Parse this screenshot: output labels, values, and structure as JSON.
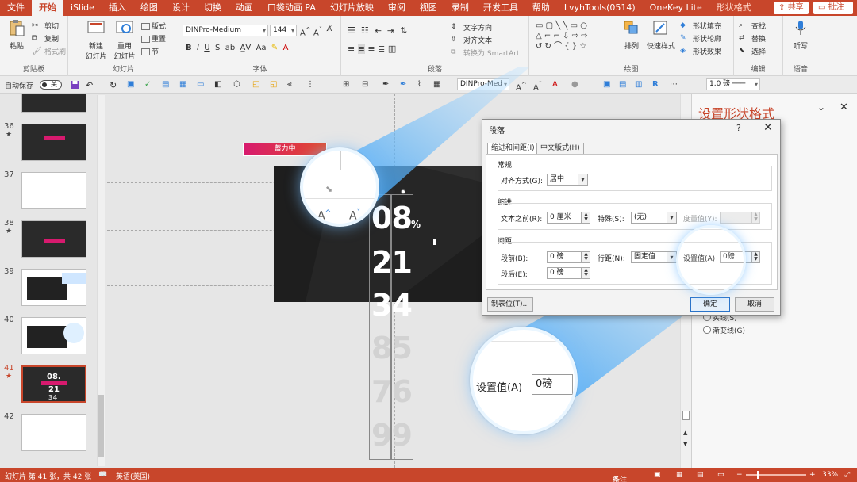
{
  "menu": {
    "tabs": [
      "文件",
      "开始",
      "iSlide",
      "插入",
      "绘图",
      "设计",
      "切换",
      "动画",
      "口袋动画 PA",
      "幻灯片放映",
      "审阅",
      "视图",
      "录制",
      "开发工具",
      "帮助",
      "LvyhTools(0514)",
      "OneKey Lite",
      "形状格式"
    ],
    "share": "共享",
    "comment": "批注"
  },
  "ribbon": {
    "clipboard": {
      "paste": "粘贴",
      "cut": "剪切",
      "copy": "复制",
      "painter": "格式刷",
      "label": "剪贴板"
    },
    "slides": {
      "new": "新建",
      "new2": "幻灯片",
      "reuse": "重用",
      "reuse2": "幻灯片",
      "layout": "版式",
      "reset": "重置",
      "section": "节",
      "label": "幻灯片"
    },
    "font": {
      "name": "DINPro-Medium",
      "size": "144",
      "label": "字体"
    },
    "paragraph": {
      "text_dir": "文字方向",
      "align_text": "对齐文本",
      "smartart": "转换为 SmartArt",
      "label": "段落"
    },
    "drawing": {
      "arrange": "排列",
      "quick_styles": "快速样式",
      "fill": "形状填充",
      "outline": "形状轮廓",
      "effect": "形状效果",
      "label": "绘图"
    },
    "editing": {
      "find": "查找",
      "replace": "替换",
      "select": "选择",
      "label": "编辑"
    },
    "voice": {
      "dictate": "听写",
      "label": "语音"
    }
  },
  "qat": {
    "autosave": "自动保存",
    "toggle": "关",
    "font": "DINPro-Med",
    "line_weight": "1.0 磅"
  },
  "thumbnails": [
    {
      "num": "36",
      "star": "★",
      "kind": "dark"
    },
    {
      "num": "37",
      "star": "",
      "kind": "blank"
    },
    {
      "num": "38",
      "star": "★",
      "kind": "dark"
    },
    {
      "num": "39",
      "star": "",
      "kind": "light"
    },
    {
      "num": "40",
      "star": "",
      "kind": "light"
    },
    {
      "num": "41",
      "star": "★",
      "kind": "selected",
      "text1": "08.",
      "text2": "21",
      "text3": "34"
    },
    {
      "num": "42",
      "star": "",
      "kind": "blank"
    }
  ],
  "slide": {
    "numbers": [
      "08",
      "21",
      "34",
      "85",
      "76",
      "99"
    ],
    "percent": "%",
    "charging": "蓄力中"
  },
  "pane": {
    "title": "设置形状格式",
    "opt1": "实线(S)",
    "opt2": "渐变线(G)"
  },
  "dialog": {
    "title": "段落",
    "help": "?",
    "tab1": "缩进和间距(I)",
    "tab2": "中文版式(H)",
    "general": "常规",
    "alignment_label": "对齐方式(G):",
    "alignment_value": "居中",
    "indent": "缩进",
    "before_text_label": "文本之前(R):",
    "before_text_value": "0 厘米",
    "special_label": "特殊(S):",
    "special_value": "(无)",
    "measure_label": "度量值(Y):",
    "spacing": "间距",
    "before_label": "段前(B):",
    "before_value": "0 磅",
    "line_label": "行距(N):",
    "line_value": "固定值",
    "setvalue_label": "设置值(A)",
    "setvalue_value": "0磅",
    "after_label": "段后(E):",
    "after_value": "0 磅",
    "tabs_btn": "制表位(T)...",
    "ok": "确定",
    "cancel": "取消"
  },
  "magnifier": {
    "label": "设置值(A)",
    "value": "0磅"
  },
  "status": {
    "slide_info": "幻灯片 第 41 张，共 42 张",
    "lang": "英语(美国)",
    "notes": "备注",
    "zoom": "33%"
  },
  "colors": {
    "accent": "#c8462b",
    "beam": "#2f9cf4"
  }
}
